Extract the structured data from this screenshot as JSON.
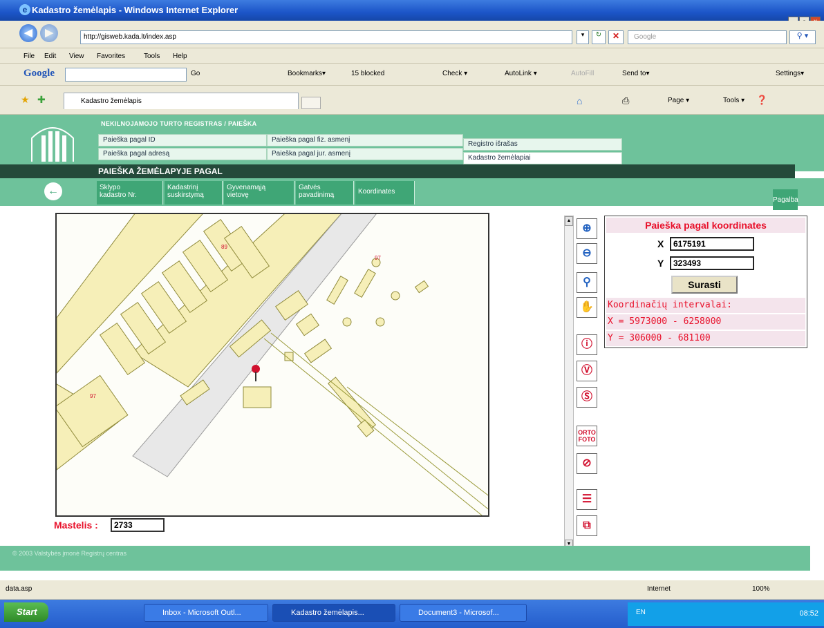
{
  "window": {
    "title": "Kadastro žemėlapis - Windows Internet Explorer"
  },
  "browser": {
    "address": "http://gisweb.kada.lt/index.asp",
    "search_placeholder": "Google",
    "menu": [
      "File",
      "Edit",
      "View",
      "Favorites",
      "Tools",
      "Help"
    ],
    "google_toolbar": [
      "Go",
      "Bookmarks▾",
      "15 blocked",
      "Check ▾",
      "AutoLink ▾",
      "AutoFill",
      "Send to▾",
      "Settings▾"
    ],
    "tab_title": "Kadastro žemėlapis",
    "cmd_bar": [
      "Page ▾",
      "Tools ▾"
    ],
    "status_left": "data.asp",
    "status_zone": "Internet",
    "zoom": "100%"
  },
  "site": {
    "breadcrumb": "NEKILNOJAMOJO TURTO REGISTRAS / PAIEŠKA",
    "menu": [
      "Paieška pagal ID",
      "Paieška pagal adresą",
      "Paieška pagal fiz. asmenį",
      "Paieška pagal jur. asmenį",
      "Registro išrašas",
      "Kadastro žemėlapiai"
    ],
    "section_title": "PAIEŠKA ŽEMĖLAPYJE PAGAL",
    "subtabs": [
      [
        "Sklypo",
        "kadastro Nr."
      ],
      [
        "Kadastrinį",
        "suskirstymą"
      ],
      [
        "Gyvenamąją",
        "vietovę"
      ],
      [
        "Gatvės",
        "pavadinimą"
      ],
      [
        "Koordinates",
        ""
      ]
    ],
    "help": "Pagalba",
    "footer": "© 2003 Valstybės įmonė Registrų centras"
  },
  "map": {
    "labels": [
      "89",
      "97",
      "97"
    ],
    "scale_label": "Mastelis :",
    "scale_value": "2733"
  },
  "tools": {
    "ortho": [
      "ORTO",
      "FOTO"
    ]
  },
  "coords": {
    "title": "Paieška pagal koordinates",
    "x_label": "X",
    "x_value": "6175191",
    "y_label": "Y",
    "y_value": "323493",
    "button": "Surasti",
    "intervals_title": "Koordinačių intervalai:",
    "x_range": "X = 5973000 - 6258000",
    "y_range": "Y = 306000 - 681100"
  },
  "taskbar": {
    "start": "Start",
    "tasks": [
      "Inbox - Microsoft Outl...",
      "Kadastro žemėlapis...",
      "Document3 - Microsof..."
    ],
    "lang": "EN",
    "clock": "08:52"
  },
  "colors": {
    "site_green": "#6ec29b",
    "tab_green": "#3fa676",
    "dark_band": "#244a3a",
    "accent_red": "#e8102a",
    "parcel_fill": "#f6efb8"
  }
}
